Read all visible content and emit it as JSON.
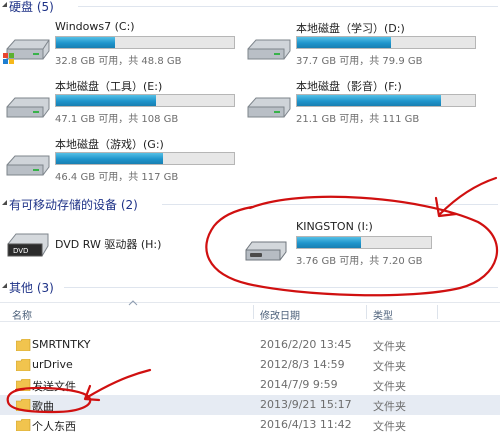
{
  "sections": {
    "hard_disk": "硬盘 (5)",
    "removable": "有可移动存储的设备 (2)",
    "other": "其他 (3)"
  },
  "drives": [
    {
      "name": "Windows7 (C:)",
      "free_text": "32.8 GB 可用，共 48.8 GB",
      "used_fraction": 0.33,
      "icon": "windows-drive-icon"
    },
    {
      "name": "本地磁盘（学习）(D:)",
      "free_text": "37.7 GB 可用，共 79.9 GB",
      "used_fraction": 0.53,
      "icon": "hard-drive-icon"
    },
    {
      "name": "本地磁盘（工具）(E:)",
      "free_text": "47.1 GB 可用，共 108 GB",
      "used_fraction": 0.56,
      "icon": "hard-drive-icon"
    },
    {
      "name": "本地磁盘（影音）(F:)",
      "free_text": "21.1 GB 可用，共 111 GB",
      "used_fraction": 0.81,
      "icon": "hard-drive-icon"
    },
    {
      "name": "本地磁盘（游戏）(G:)",
      "free_text": "46.4 GB 可用，共 117 GB",
      "used_fraction": 0.6,
      "icon": "hard-drive-icon"
    }
  ],
  "dvd": {
    "name": "DVD RW 驱动器 (H:)",
    "icon": "dvd-drive-icon"
  },
  "kingston": {
    "name": "KINGSTON (I:)",
    "free_text": "3.76 GB 可用，共 7.20 GB",
    "used_fraction": 0.48,
    "icon": "usb-drive-icon"
  },
  "columns": {
    "name": "名称",
    "date": "修改日期",
    "type": "类型"
  },
  "files": [
    {
      "name": "SMRTNTKY",
      "date": "2016/2/20 13:45",
      "type": "文件夹"
    },
    {
      "name": "urDrive",
      "date": "2012/8/3 14:59",
      "type": "文件夹"
    },
    {
      "name": "发送文件",
      "date": "2014/7/9 9:59",
      "type": "文件夹"
    },
    {
      "name": "歌曲",
      "date": "2013/9/21 15:17",
      "type": "文件夹"
    },
    {
      "name": "个人东西",
      "date": "2016/4/13 11:42",
      "type": "文件夹"
    }
  ],
  "colors": {
    "accent": "#1f95cc",
    "annotation": "#d01010",
    "section_text": "#1e3287"
  }
}
